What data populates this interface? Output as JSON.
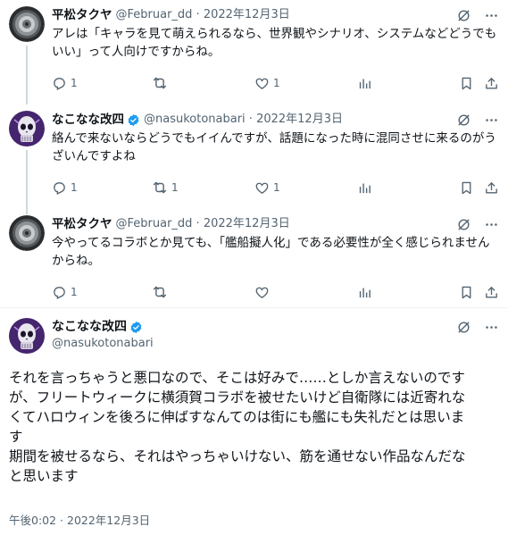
{
  "tweets": [
    {
      "name": "平松タクヤ",
      "handle_time": "@Februar_dd · 2022年12月3日",
      "text": "アレは「キャラを見て萌えられるなら、世界観やシナリオ、システムなどどうでもいい」って人向けですからね。",
      "replies": "1",
      "retweets": "",
      "likes": "1",
      "verified": false
    },
    {
      "name": "なこなな改四",
      "handle_time": "@nasukotonabari · 2022年12月3日",
      "text": "絡んで来ないならどうでもイイんですが、話題になった時に混同させに来るのがうざいんですよね",
      "replies": "1",
      "retweets": "1",
      "likes": "1",
      "verified": true
    },
    {
      "name": "平松タクヤ",
      "handle_time": "@Februar_dd · 2022年12月3日",
      "text": "今やってるコラボとか見ても、「艦船擬人化」である必要性が全く感じられませんからね。",
      "replies": "1",
      "retweets": "",
      "likes": "",
      "verified": false
    }
  ],
  "main": {
    "name": "なこなな改四",
    "handle": "@nasukotonabari",
    "verified": true,
    "text_lines": [
      "それを言っちゃうと悪口なので、そこは好みで……としか言えないのです",
      "が、フリートウィークに横須賀コラボを被せたいけど自衛隊には近寄れな",
      "くてハロウィンを後ろに伸ばすなんてのは街にも艦にも失礼だとは思いま",
      "す",
      "期間を被せるなら、それはやっちゃいけない、筋を通せない作品なんだな",
      "と思います"
    ],
    "timestamp": "午後0:02 · 2022年12月3日"
  },
  "colors": {
    "text": "#0f1419",
    "secondary": "#536471",
    "verified": "#1d9bf0",
    "divider": "#eff3f4",
    "thread_line": "#cfd9de"
  },
  "icons": {
    "grok": "slash-circle-icon",
    "more": "more-icon",
    "reply": "reply-icon",
    "retweet": "retweet-icon",
    "like": "heart-icon",
    "views": "views-icon",
    "bookmark": "bookmark-icon",
    "share": "share-icon"
  }
}
